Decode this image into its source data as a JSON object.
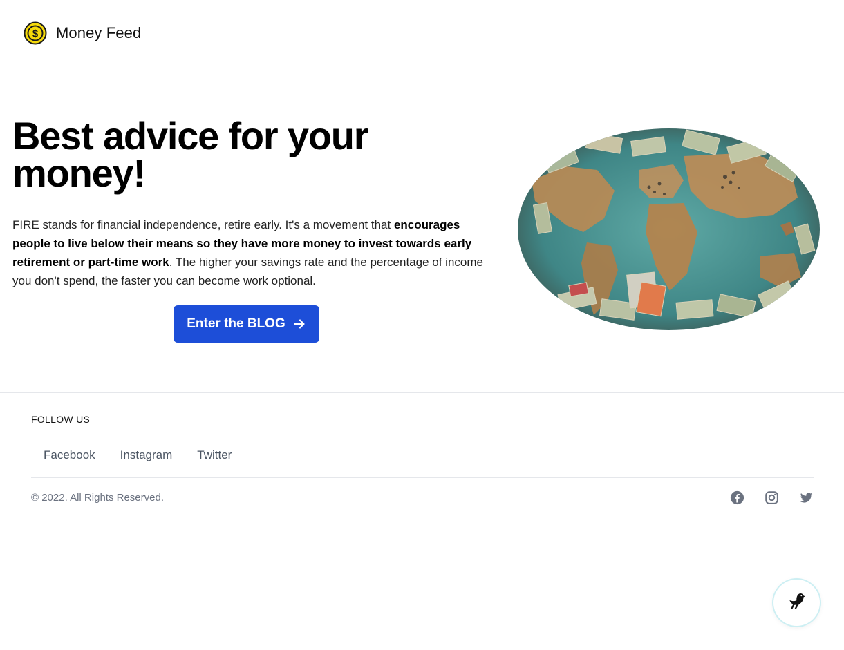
{
  "header": {
    "brand": "Money Feed",
    "logo_icon": "dollar-coin-icon",
    "logo_color": "#f5d90a"
  },
  "hero": {
    "title": "Best advice for your money!",
    "text_part1": "FIRE stands for financial independence, retire early. It's a movement that ",
    "text_bold": "encourages people to live below their means so they have more money to invest towards early retirement or part-time work",
    "text_part2": ". The higher your savings rate and the percentage of income you don't spend, the faster you can become work optional.",
    "cta_label": "Enter the BLOG",
    "cta_icon": "arrow-right-icon",
    "cta_color": "#1d4ed8",
    "image_alt": "world map covered with banknotes"
  },
  "footer": {
    "follow_heading": "FOLLOW US",
    "links": [
      "Facebook",
      "Instagram",
      "Twitter"
    ],
    "copyright": "© 2022. All Rights Reserved.",
    "icons": [
      "facebook-icon",
      "instagram-icon",
      "twitter-icon"
    ],
    "icon_color": "#6b7280"
  },
  "widget": {
    "icon": "bird-icon"
  }
}
